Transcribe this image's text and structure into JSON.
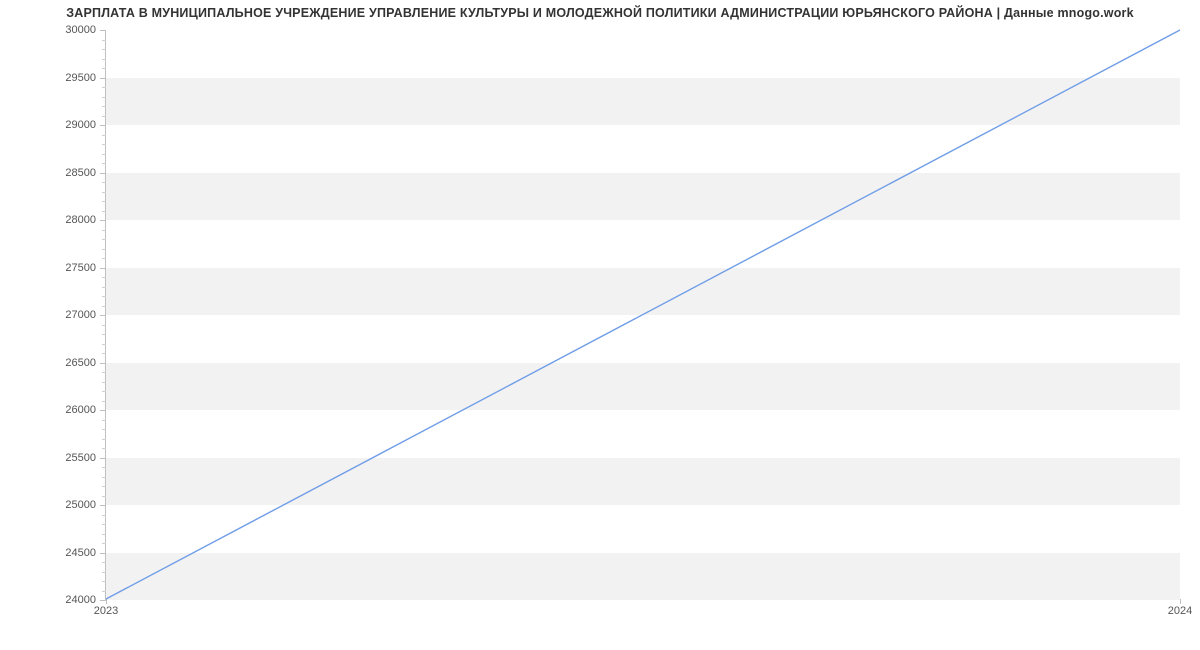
{
  "chart_data": {
    "type": "line",
    "title": "ЗАРПЛАТА В МУНИЦИПАЛЬНОЕ УЧРЕЖДЕНИЕ УПРАВЛЕНИЕ КУЛЬТУРЫ И МОЛОДЕЖНОЙ ПОЛИТИКИ АДМИНИСТРАЦИИ ЮРЬЯНСКОГО РАЙОНА | Данные mnogo.work",
    "x": [
      "2023",
      "2024"
    ],
    "values": [
      24000,
      30000
    ],
    "xlabel": "",
    "ylabel": "",
    "xlim": [
      "2023",
      "2024"
    ],
    "ylim": [
      24000,
      30000
    ],
    "y_ticks": [
      24000,
      24500,
      25000,
      25500,
      26000,
      26500,
      27000,
      27500,
      28000,
      28500,
      29000,
      29500,
      30000
    ],
    "line_color": "#6f9de8",
    "band_color": "#f2f2f2",
    "grid": true,
    "legend": false
  },
  "x_tick_labels": {
    "left": "2023",
    "right": "2024"
  }
}
